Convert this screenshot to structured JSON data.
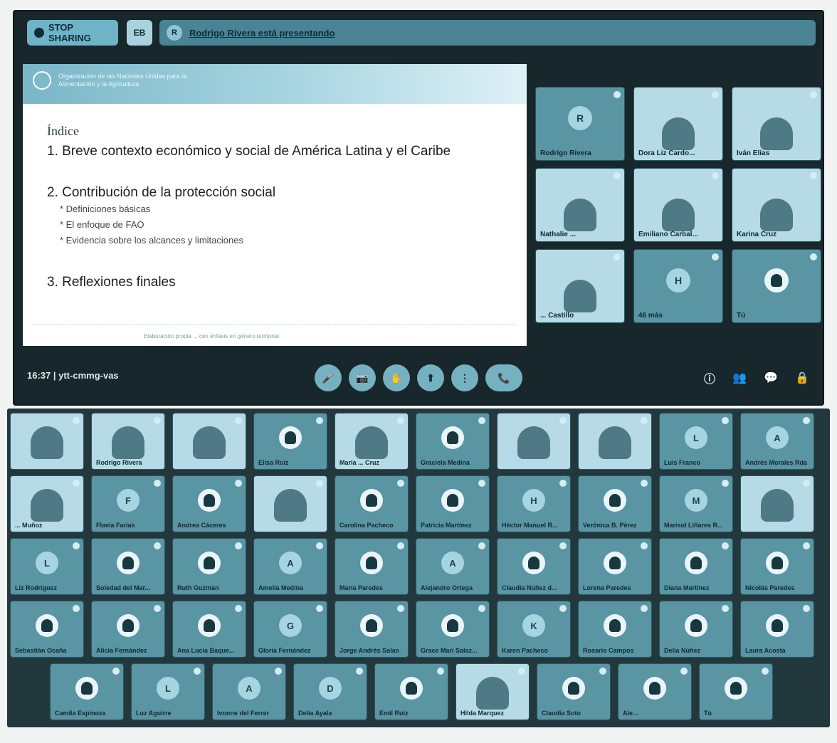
{
  "top_bar": {
    "stop_label": "STOP SHARING",
    "square_label": "EB",
    "presenter_initial": "R",
    "presenting_text": "Rodrigo Rivera está presentando"
  },
  "slide": {
    "org_text": "Organización de las Naciones Unidas para la Alimentación y la Agricultura",
    "title": "Índice",
    "item1": "1. Breve contexto económico y social de América Latina y el Caribe",
    "item2": "2. Contribución de la protección social",
    "sub1": "* Definiciones básicas",
    "sub2": "* El enfoque de FAO",
    "sub3": "* Evidencia sobre los alcances y limitaciones",
    "item3": "3. Reflexiones finales",
    "footer": "Elaboración propia ... con énfasis en género territorial"
  },
  "side_tiles": [
    {
      "initial": "R",
      "name": "Rodrigo Rivera",
      "kind": "avatar"
    },
    {
      "initial": "",
      "name": "Dora Liz Cardo...",
      "kind": "photo"
    },
    {
      "initial": "",
      "name": "Iván Elías",
      "kind": "photo"
    },
    {
      "initial": "",
      "name": "Nathalie ...",
      "kind": "photo"
    },
    {
      "initial": "",
      "name": "Emiliano Carbal...",
      "kind": "photo"
    },
    {
      "initial": "",
      "name": "Karina Cruz",
      "kind": "photo"
    },
    {
      "initial": "",
      "name": "... Castillo",
      "kind": "photo"
    },
    {
      "initial": "H",
      "name": "46 más",
      "kind": "avatar"
    },
    {
      "initial": "",
      "name": "Tú",
      "kind": "avatar-photo"
    }
  ],
  "bottom_bar": {
    "time": "16:37",
    "meeting_code": "ytt-cmmg-vas",
    "controls": [
      "🎤",
      "📷",
      "✋",
      "⬆",
      "⋮",
      "📞"
    ],
    "right_icons": [
      "ⓘ",
      "👥",
      "💬",
      "🔒"
    ]
  },
  "gallery_rows": [
    [
      {
        "name": "",
        "initial": "",
        "kind": "photo"
      },
      {
        "name": "Rodrigo Rivera",
        "initial": "",
        "kind": "photo"
      },
      {
        "name": "",
        "initial": "",
        "kind": "photo"
      },
      {
        "name": "Elisa Ruiz",
        "initial": "",
        "kind": "avatar-photo"
      },
      {
        "name": "Maria ... Cruz",
        "initial": "",
        "kind": "photo"
      },
      {
        "name": "Graciela Medina",
        "initial": "",
        "kind": "avatar-photo"
      },
      {
        "name": "",
        "initial": "",
        "kind": "photo"
      },
      {
        "name": "",
        "initial": "",
        "kind": "photo"
      },
      {
        "name": "Luis Franco",
        "initial": "L",
        "kind": "avatar"
      },
      {
        "name": "Andrés Morales Rda",
        "initial": "A",
        "kind": "avatar"
      }
    ],
    [
      {
        "name": "... Muñoz",
        "initial": "",
        "kind": "photo"
      },
      {
        "name": "Flavia Farías",
        "initial": "F",
        "kind": "avatar"
      },
      {
        "name": "Andrea Cáceres",
        "initial": "",
        "kind": "avatar-photo"
      },
      {
        "name": "",
        "initial": "",
        "kind": "photo"
      },
      {
        "name": "Carolina Pacheco",
        "initial": "",
        "kind": "avatar-photo"
      },
      {
        "name": "Patricia Martínez",
        "initial": "",
        "kind": "avatar-photo"
      },
      {
        "name": "Héctor Manuel R...",
        "initial": "H",
        "kind": "avatar"
      },
      {
        "name": "Verónica B. Pérez",
        "initial": "",
        "kind": "avatar-photo"
      },
      {
        "name": "Marisol Liñares R...",
        "initial": "M",
        "kind": "avatar"
      },
      {
        "name": "",
        "initial": "",
        "kind": "photo"
      }
    ],
    [
      {
        "name": "Liz Rodríguez",
        "initial": "L",
        "kind": "avatar"
      },
      {
        "name": "Soledad del Mar...",
        "initial": "",
        "kind": "avatar-photo"
      },
      {
        "name": "Ruth Guzmán",
        "initial": "",
        "kind": "avatar-photo"
      },
      {
        "name": "Amelia Medina",
        "initial": "A",
        "kind": "avatar"
      },
      {
        "name": "María Paredes",
        "initial": "",
        "kind": "avatar-photo"
      },
      {
        "name": "Alejandro Ortega",
        "initial": "A",
        "kind": "avatar"
      },
      {
        "name": "Claudia Núñez d...",
        "initial": "",
        "kind": "avatar-photo"
      },
      {
        "name": "Lorena Paredes",
        "initial": "",
        "kind": "avatar-photo"
      },
      {
        "name": "Diana Martínez",
        "initial": "",
        "kind": "avatar-photo"
      },
      {
        "name": "Nicolás Paredes",
        "initial": "",
        "kind": "avatar-photo"
      }
    ],
    [
      {
        "name": "Sebastián Ocaña",
        "initial": "",
        "kind": "avatar-photo"
      },
      {
        "name": "Alicia Fernández",
        "initial": "",
        "kind": "avatar-photo"
      },
      {
        "name": "Ana Lucía Baque...",
        "initial": "",
        "kind": "avatar-photo"
      },
      {
        "name": "Gloria Fernández",
        "initial": "G",
        "kind": "avatar"
      },
      {
        "name": "Jorge Andrés Salas",
        "initial": "",
        "kind": "avatar-photo"
      },
      {
        "name": "Grace Marí Salaz...",
        "initial": "",
        "kind": "avatar-photo"
      },
      {
        "name": "Karen Pacheco",
        "initial": "K",
        "kind": "avatar"
      },
      {
        "name": "Rosario Campos",
        "initial": "",
        "kind": "avatar-photo"
      },
      {
        "name": "Delia Núñez",
        "initial": "",
        "kind": "avatar-photo"
      },
      {
        "name": "Laura Acosta",
        "initial": "",
        "kind": "avatar-photo"
      }
    ],
    [
      {
        "name": "Camila Espinoza",
        "initial": "",
        "kind": "avatar-photo"
      },
      {
        "name": "Luz Aguirre",
        "initial": "L",
        "kind": "avatar"
      },
      {
        "name": "Ivonne del Ferrer",
        "initial": "A",
        "kind": "avatar"
      },
      {
        "name": "Delia Ayala",
        "initial": "D",
        "kind": "avatar"
      },
      {
        "name": "Emil Ruiz",
        "initial": "",
        "kind": "avatar-photo"
      },
      {
        "name": "Hilda Marquez",
        "initial": "",
        "kind": "photo"
      },
      {
        "name": "Claudia Soto",
        "initial": "",
        "kind": "avatar-photo"
      },
      {
        "name": "Ale...",
        "initial": "",
        "kind": "avatar-photo"
      },
      {
        "name": "Tú",
        "initial": "",
        "kind": "avatar-photo"
      }
    ]
  ]
}
